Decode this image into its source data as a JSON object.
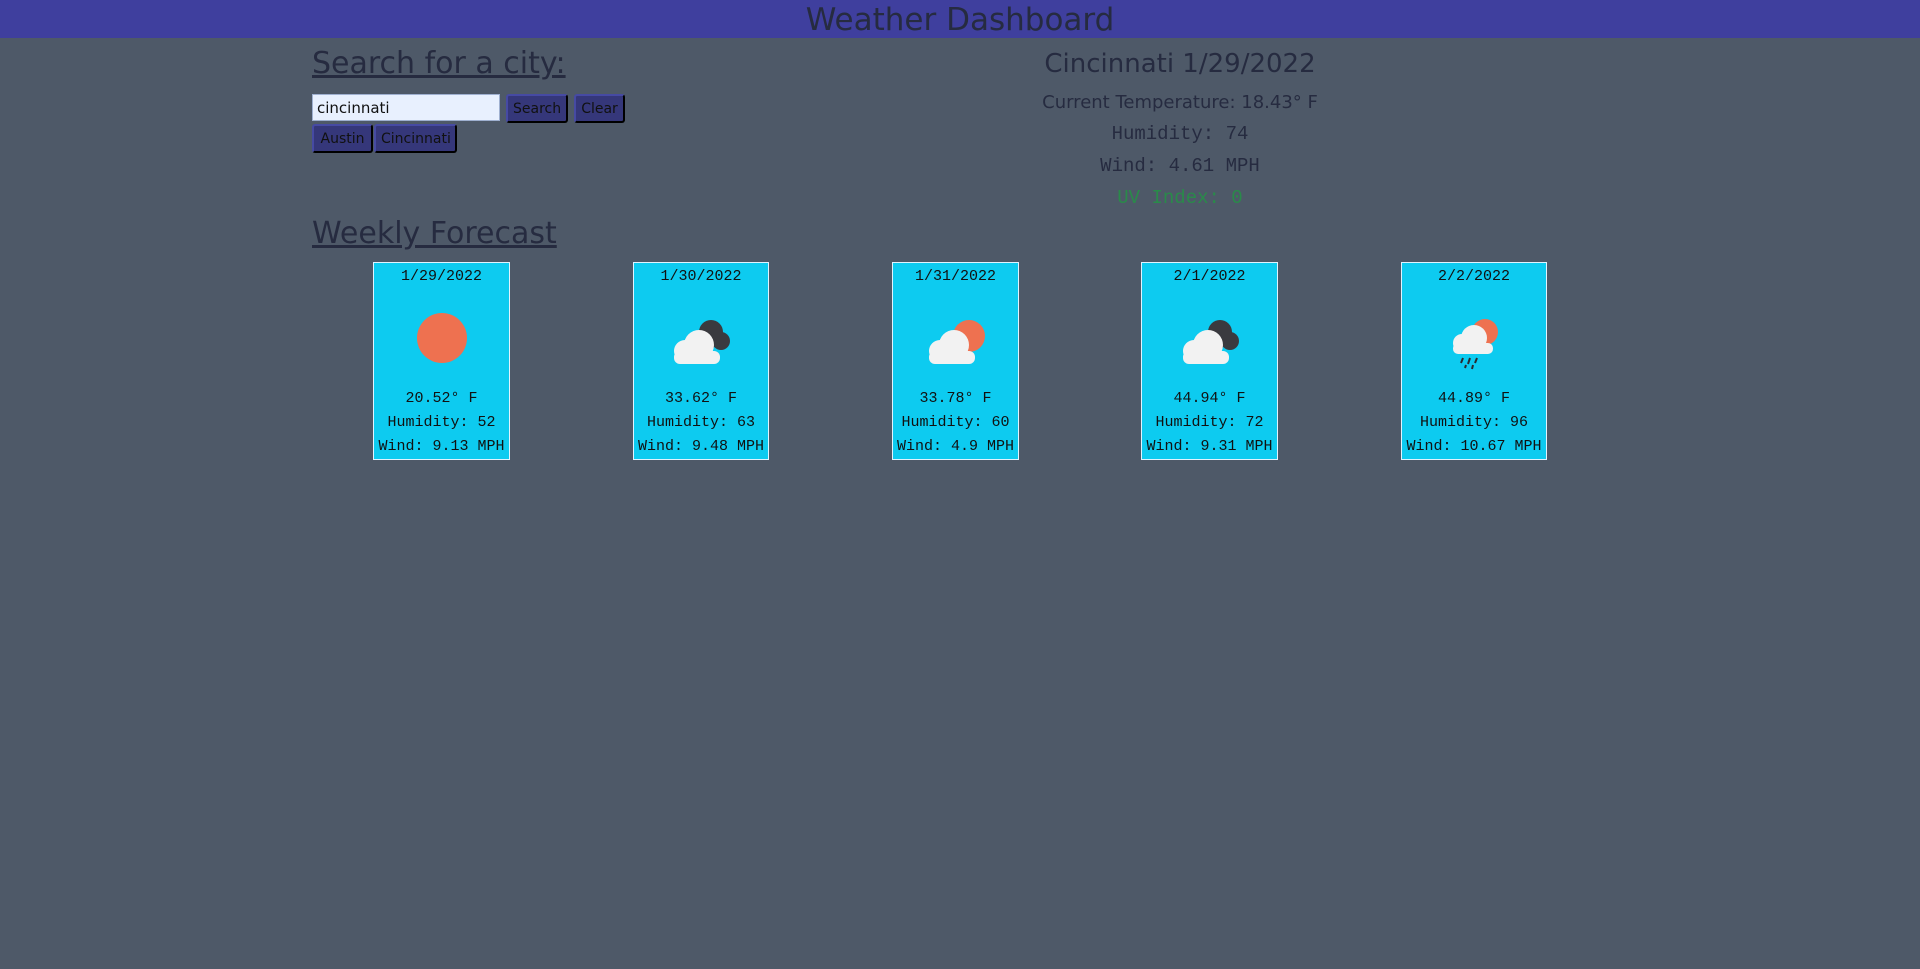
{
  "header": {
    "title": "Weather Dashboard"
  },
  "search": {
    "heading": "Search for a city:",
    "input_value": "cincinnati",
    "search_label": "Search",
    "clear_label": "Clear",
    "history": [
      "Austin",
      "Cincinnati"
    ]
  },
  "current": {
    "title": "Cincinnati 1/29/2022",
    "temperature": "Current Temperature: 18.43° F",
    "humidity": "Humidity: 74",
    "wind": "Wind: 4.61 MPH",
    "uv": "UV Index: 0",
    "uv_color": "#2a8a4a"
  },
  "forecast": {
    "heading": "Weekly Forecast",
    "days": [
      {
        "date": "1/29/2022",
        "icon": "sun-icon",
        "temp": "20.52° F",
        "humidity": "Humidity: 52",
        "wind": "Wind: 9.13 MPH"
      },
      {
        "date": "1/30/2022",
        "icon": "dark-clouds-icon",
        "temp": "33.62° F",
        "humidity": "Humidity: 63",
        "wind": "Wind: 9.48 MPH"
      },
      {
        "date": "1/31/2022",
        "icon": "partly-cloudy-icon",
        "temp": "33.78° F",
        "humidity": "Humidity: 60",
        "wind": "Wind: 4.9 MPH"
      },
      {
        "date": "2/1/2022",
        "icon": "dark-clouds-icon",
        "temp": "44.94° F",
        "humidity": "Humidity: 72",
        "wind": "Wind: 9.31 MPH"
      },
      {
        "date": "2/2/2022",
        "icon": "rain-sun-icon",
        "temp": "44.89° F",
        "humidity": "Humidity: 96",
        "wind": "Wind: 10.67 MPH"
      }
    ]
  },
  "colors": {
    "header_bar": "#3f3f9e",
    "background": "#4e5968",
    "card": "#0dcbf0",
    "button": "#35377a",
    "sun": "#ee7150"
  }
}
